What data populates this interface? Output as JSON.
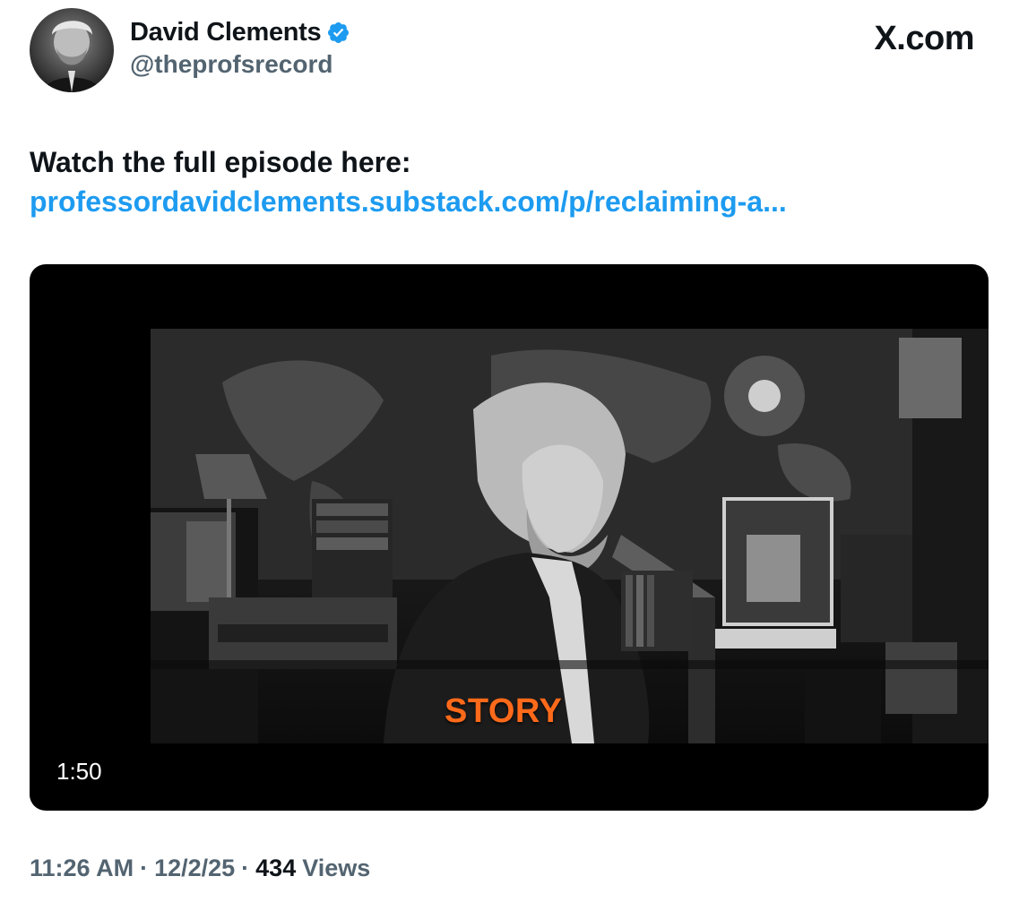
{
  "author": {
    "display_name": "David Clements",
    "handle": "@theprofsrecord",
    "verified_icon": "verified-badge-icon"
  },
  "brand": "X.com",
  "tweet": {
    "text": "Watch the full episode here:",
    "link_text": "professordavidclements.substack.com/p/reclaiming-a..."
  },
  "video": {
    "caption": "STORY",
    "duration": "1:50"
  },
  "meta": {
    "time": "11:26 AM",
    "sep1": "·",
    "date": "12/2/25",
    "sep2": "·",
    "views_count": "434",
    "views_label": "Views"
  },
  "colors": {
    "link": "#1d9bf0",
    "verified": "#1d9bf0",
    "caption": "#ff6a1a",
    "secondary_text": "#536471"
  }
}
